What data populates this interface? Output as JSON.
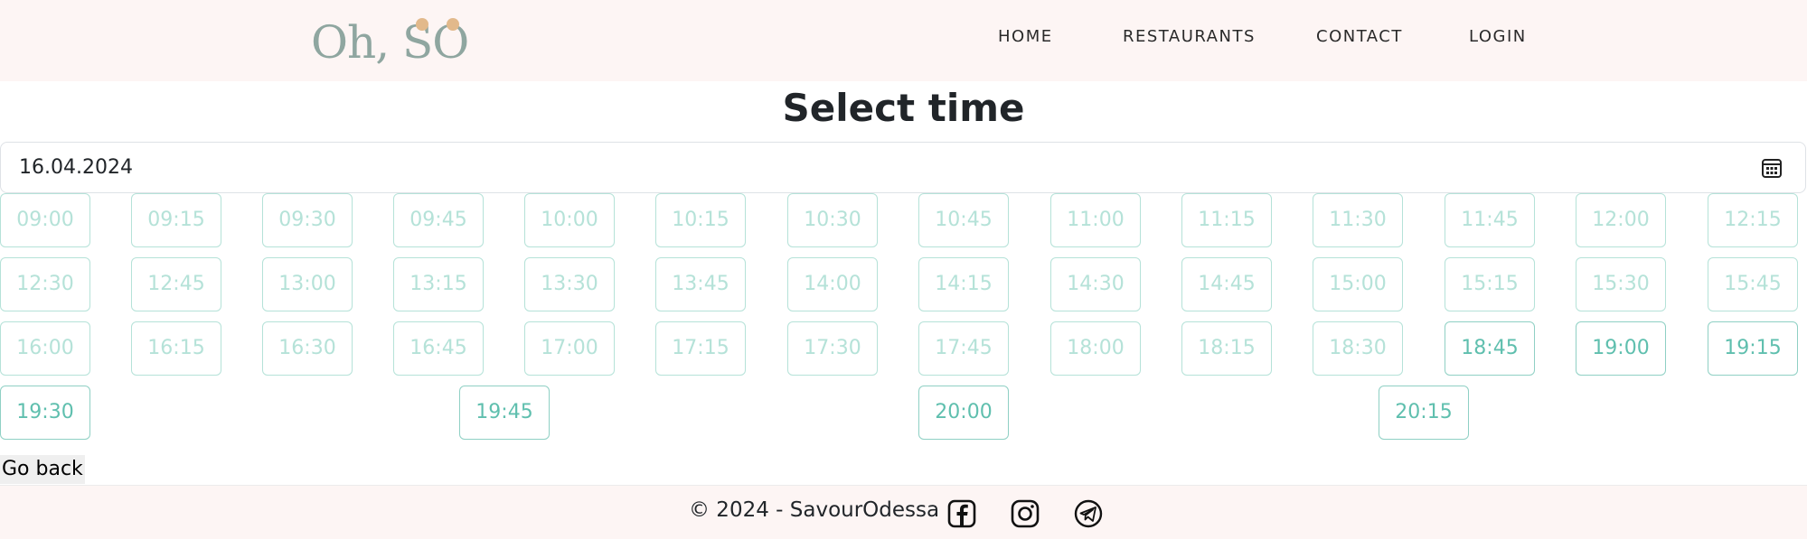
{
  "brand": {
    "logo_text": "Oh, SO"
  },
  "nav": {
    "items": [
      "HOME",
      "RESTAURANTS",
      "CONTACT",
      "LOGIN"
    ]
  },
  "page": {
    "title": "Select time"
  },
  "date": {
    "value": "16.04.2024",
    "icon": "calendar-icon"
  },
  "colors": {
    "navbar_bg": "#fdf5f4",
    "slot_accent": "#9fd6cb",
    "logo_accent": "#e2b98b"
  },
  "slots": {
    "disabled": [
      "09:00",
      "09:15",
      "09:30",
      "09:45",
      "10:00",
      "10:15",
      "10:30",
      "10:45",
      "11:00",
      "11:15",
      "11:30",
      "11:45",
      "12:00",
      "12:15",
      "12:30",
      "12:45",
      "13:00",
      "13:15",
      "13:30",
      "13:45",
      "14:00",
      "14:15",
      "14:30",
      "14:45",
      "15:00",
      "15:15",
      "15:30",
      "15:45",
      "16:00",
      "16:15",
      "16:30",
      "16:45",
      "17:00",
      "17:15",
      "17:30",
      "17:45",
      "18:00",
      "18:15",
      "18:30"
    ],
    "available": [
      "18:45",
      "19:00",
      "19:15",
      "19:30",
      "19:45",
      "20:00",
      "20:15"
    ]
  },
  "actions": {
    "go_back": "Go back"
  },
  "footer": {
    "copyright": "© 2024 - SavourOdessa",
    "social_icons": [
      "facebook-icon",
      "instagram-icon",
      "telegram-icon"
    ]
  }
}
